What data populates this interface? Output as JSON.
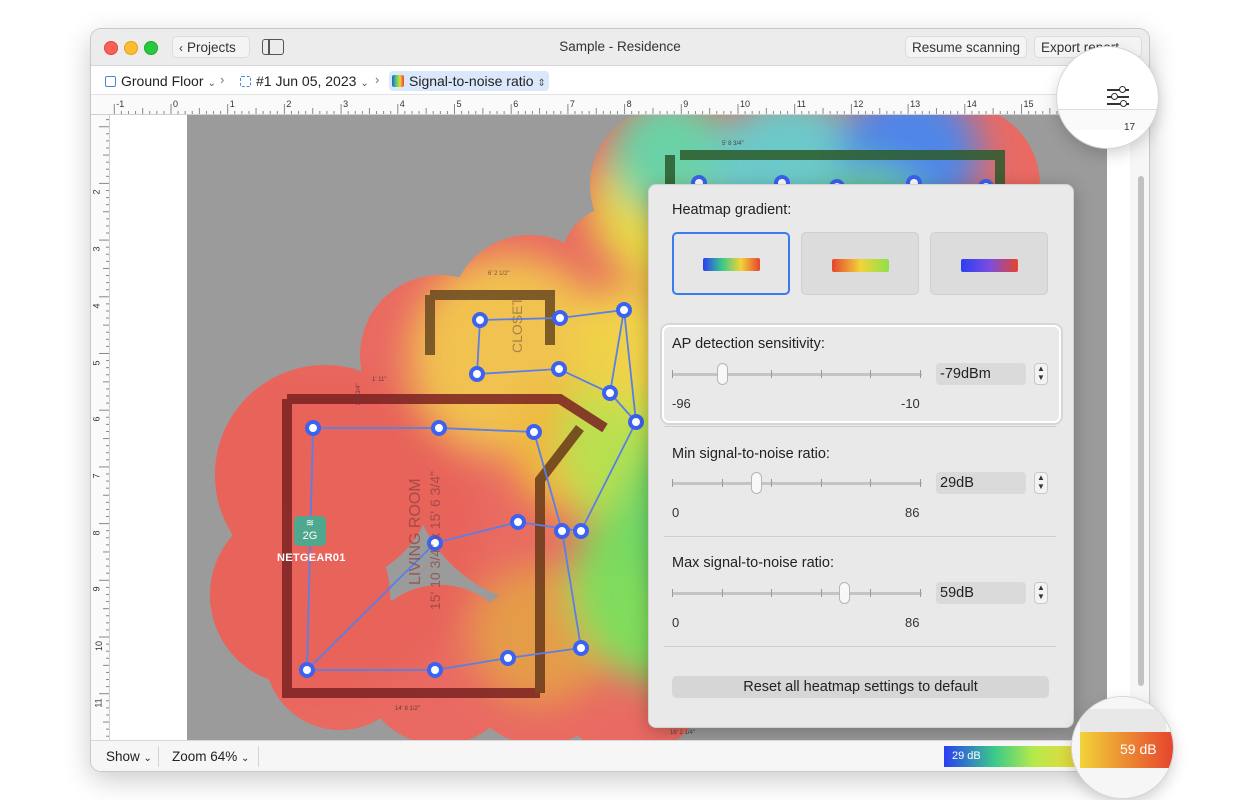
{
  "window": {
    "title": "Sample - Residence",
    "projects_label": "Projects",
    "resume_label": "Resume scanning",
    "export_label": "Export report..."
  },
  "breadcrumbs": {
    "floor": "Ground Floor",
    "survey": "#1 Jun 05, 2023",
    "visualization": "Signal-to-noise ratio"
  },
  "ruler": {
    "h_labels": [
      "-1",
      "0",
      "1",
      "2",
      "3",
      "4",
      "5",
      "6",
      "7",
      "8",
      "9",
      "10",
      "11",
      "12",
      "13",
      "14",
      "15",
      "17"
    ],
    "v_labels": [
      "2",
      "3",
      "4",
      "5",
      "6",
      "7",
      "8",
      "9",
      "10",
      "11",
      "12"
    ]
  },
  "map": {
    "ap_band": "2G",
    "ap_name": "NETGEAR01",
    "room_labels": [
      "CLOSET",
      "LIVING ROOM",
      "15' 10 3/4\" x 15' 6 3/4\""
    ],
    "dimension_labels": [
      "6' 2 1/2\"",
      "14' 8 1/2\"",
      "16' 2 1/4\"",
      "5' 8 3/4\"",
      "1' 11\"",
      "2' 8 3/4\""
    ]
  },
  "panel": {
    "gradient_label": "Heatmap gradient:",
    "gradient_selected_index": 0,
    "ap_sensitivity": {
      "label": "AP detection sensitivity:",
      "value": "-79dBm",
      "min": "-96",
      "max": "-10",
      "level": 0.198
    },
    "min_snr": {
      "label": "Min signal-to-noise ratio:",
      "value": "29dB",
      "min": "0",
      "max": "86",
      "level": 0.337
    },
    "max_snr": {
      "label": "Max signal-to-noise ratio:",
      "value": "59dB",
      "min": "0",
      "max": "86",
      "level": 0.686
    },
    "reset_label": "Reset all heatmap settings to default"
  },
  "bottom_bar": {
    "show_label": "Show",
    "zoom_label": "Zoom 64%",
    "legend_min": "29 dB",
    "legend_max": "59 dB"
  },
  "magnifier": {
    "ruler_label": "17",
    "icon": "sliders-icon"
  },
  "colors": {
    "accent": "#3b7bf0",
    "ap_badge": "#4fa88e",
    "heat_red": "#e5452e",
    "heat_yellow": "#f2d33a",
    "heat_green": "#5ad46a",
    "heat_blue": "#2b3ef2"
  }
}
